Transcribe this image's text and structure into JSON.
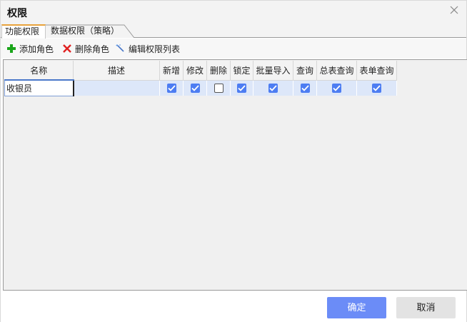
{
  "window": {
    "title": "权限"
  },
  "tabs": [
    {
      "label": "功能权限",
      "active": true
    },
    {
      "label": "数据权限（策略）",
      "active": false
    }
  ],
  "toolbar": {
    "add_label": "添加角色",
    "delete_label": "删除角色",
    "edit_label": "编辑权限列表",
    "add_icon": "plus-icon",
    "delete_icon": "x-icon",
    "edit_icon": "wand-icon"
  },
  "grid": {
    "columns": [
      "名称",
      "描述",
      "新增",
      "修改",
      "删除",
      "锁定",
      "批量导入",
      "查询",
      "总表查询",
      "表单查询"
    ],
    "rows": [
      {
        "name": "收银员",
        "description": "",
        "permissions": [
          true,
          true,
          false,
          true,
          true,
          true,
          true,
          true
        ]
      }
    ]
  },
  "footer": {
    "ok_label": "确定",
    "cancel_label": "取消"
  },
  "colors": {
    "accent": "#6b8cf7",
    "checkbox": "#4d7df2",
    "row_selected": "#dde7f9",
    "tab_accent": "#e8a23a"
  }
}
